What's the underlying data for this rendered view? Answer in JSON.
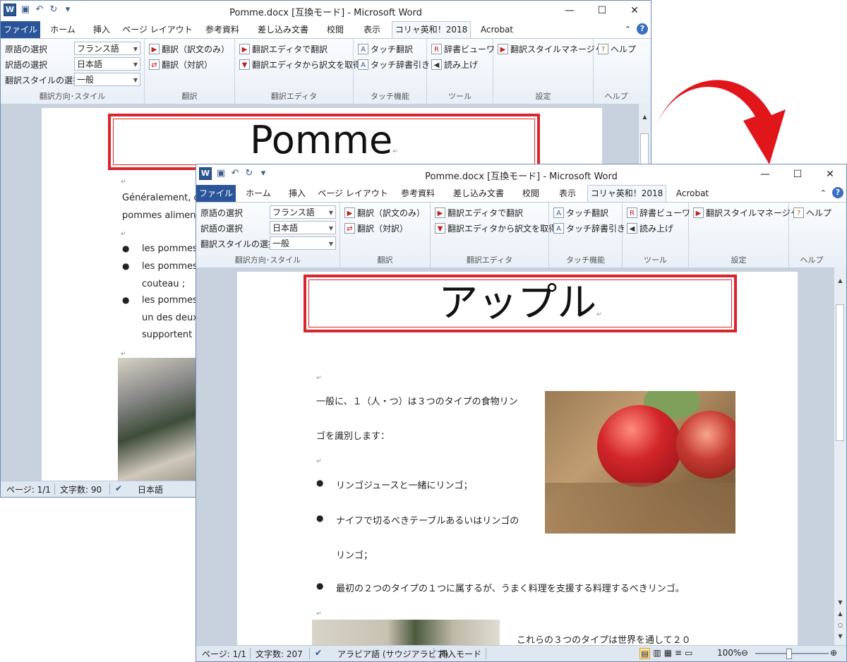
{
  "back_window": {
    "title": "Pomme.docx [互換モード] - Microsoft Word",
    "doc": {
      "heading": "Pomme",
      "para_line1": "Généralement, d",
      "para_line2": "pommes alimen",
      "bullets": [
        "les pommes",
        "les pommes",
        "couteau ;",
        "les pommes",
        "un des deux",
        "supportent"
      ]
    },
    "status": {
      "page": "ページ: 1/1",
      "words": "文字数: 90",
      "lang": "日本語"
    }
  },
  "front_window": {
    "title": "Pomme.docx [互換モード] - Microsoft Word",
    "doc": {
      "heading": "アップル",
      "para_line1": "一般に、１（人・つ）は３つのタイプの食物リン",
      "para_line2": "ゴを識別します：",
      "bullet1": "リンゴジュースと一緒にリンゴ；",
      "bullet2_line1": "ナイフで切るべきテーブルあるいはリンゴの",
      "bullet2_line2": "リンゴ；",
      "bullet3": "最初の２つのタイプの１つに属するが、うまく料理を支援する料理するべきリンゴ。",
      "bottom_text": "これらの３つのタイプは世界を通して２０"
    },
    "status": {
      "page": "ページ: 1/1",
      "words": "文字数: 207",
      "lang": "アラビア語 (サウジアラビア)",
      "mode": "挿入モード",
      "zoom": "100%"
    }
  },
  "tabs": [
    "ファイル",
    "ホーム",
    "挿入",
    "ページ レイアウト",
    "参考資料",
    "差し込み文書",
    "校閲",
    "表示",
    "コリャ英和！2018",
    "Acrobat"
  ],
  "ribbon": {
    "source_lang_label": "原語の選択",
    "source_lang_value": "フランス語",
    "target_lang_label": "訳語の選択",
    "target_lang_value": "日本語",
    "style_label": "翻訳スタイルの選択",
    "style_value": "一般",
    "group1_label": "翻訳方向･スタイル",
    "translate_only": "翻訳（訳文のみ）",
    "translate_pair": "翻訳（対訳）",
    "group2_label": "翻訳",
    "editor_translate": "翻訳エディタで翻訳",
    "editor_fetch": "翻訳エディタから訳文を取得",
    "group3_label": "翻訳エディタ",
    "touch_translate": "タッチ翻訳",
    "touch_dict": "タッチ辞書引き",
    "group4_label": "タッチ機能",
    "dict_viewer": "辞書ビューワ",
    "read_aloud": "読み上げ",
    "group5_label": "ツール",
    "style_manager": "翻訳スタイルマネージャ",
    "group6_label": "設定",
    "help": "ヘルプ",
    "group7_label": "ヘルプ"
  },
  "colors": {
    "accent": "#2a5699",
    "highlight_frame": "#d9262c",
    "arrow": "#e0161b"
  }
}
